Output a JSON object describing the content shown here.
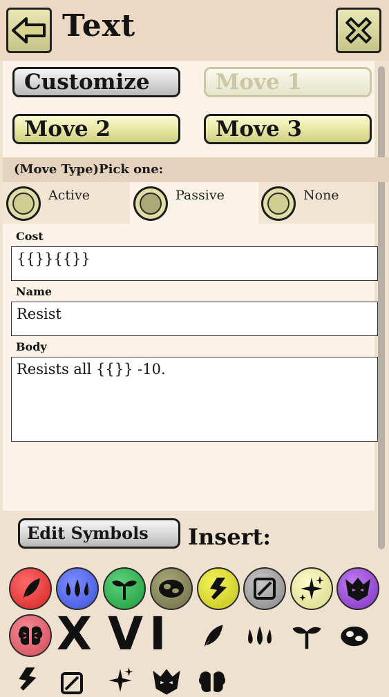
{
  "header": {
    "title": "Text",
    "back_icon": "back-arrow-icon",
    "close_icon": "close-x-icon"
  },
  "tabs": [
    {
      "label": "Customize",
      "state": "selected"
    },
    {
      "label": "Move 1",
      "state": "disabled"
    },
    {
      "label": "Move 2",
      "state": "normal"
    },
    {
      "label": "Move 3",
      "state": "normal"
    }
  ],
  "move_type": {
    "heading": "(Move Type)Pick one:",
    "options": [
      {
        "label": "Active"
      },
      {
        "label": "Passive"
      },
      {
        "label": "None"
      }
    ]
  },
  "fields": {
    "cost": {
      "label": "Cost",
      "value": "{{}}{{}}"
    },
    "name": {
      "label": "Name",
      "value": "Resist"
    },
    "body": {
      "label": "Body",
      "value": "Resists all {{}} -10."
    }
  },
  "symbols": {
    "edit_label": "Edit Symbols",
    "insert_label": "Insert:",
    "colored": [
      {
        "icon": "fire-leaf-icon",
        "color": "#e23a3a"
      },
      {
        "icon": "water-drops-icon",
        "color": "#4f63e0"
      },
      {
        "icon": "grass-sprout-icon",
        "color": "#2fa84a"
      },
      {
        "icon": "earth-rock-icon",
        "color": "#8a8a55"
      },
      {
        "icon": "lightning-icon",
        "color": "#d8d824"
      },
      {
        "icon": "void-slash-icon",
        "color": "#9c9c9c"
      },
      {
        "icon": "sparkle-icon",
        "color": "#e6e69a"
      },
      {
        "icon": "dark-demon-icon",
        "color": "#9b4fd6"
      },
      {
        "icon": "psychic-brain-icon",
        "color": "#e35e6a"
      }
    ],
    "roman": [
      "X",
      "V",
      "I"
    ],
    "plain": [
      "leaf-icon",
      "drops-icon",
      "sprout-icon",
      "rock-icon",
      "lightning-icon",
      "void-icon",
      "sparkle-icon",
      "demon-icon",
      "brain-icon"
    ]
  }
}
